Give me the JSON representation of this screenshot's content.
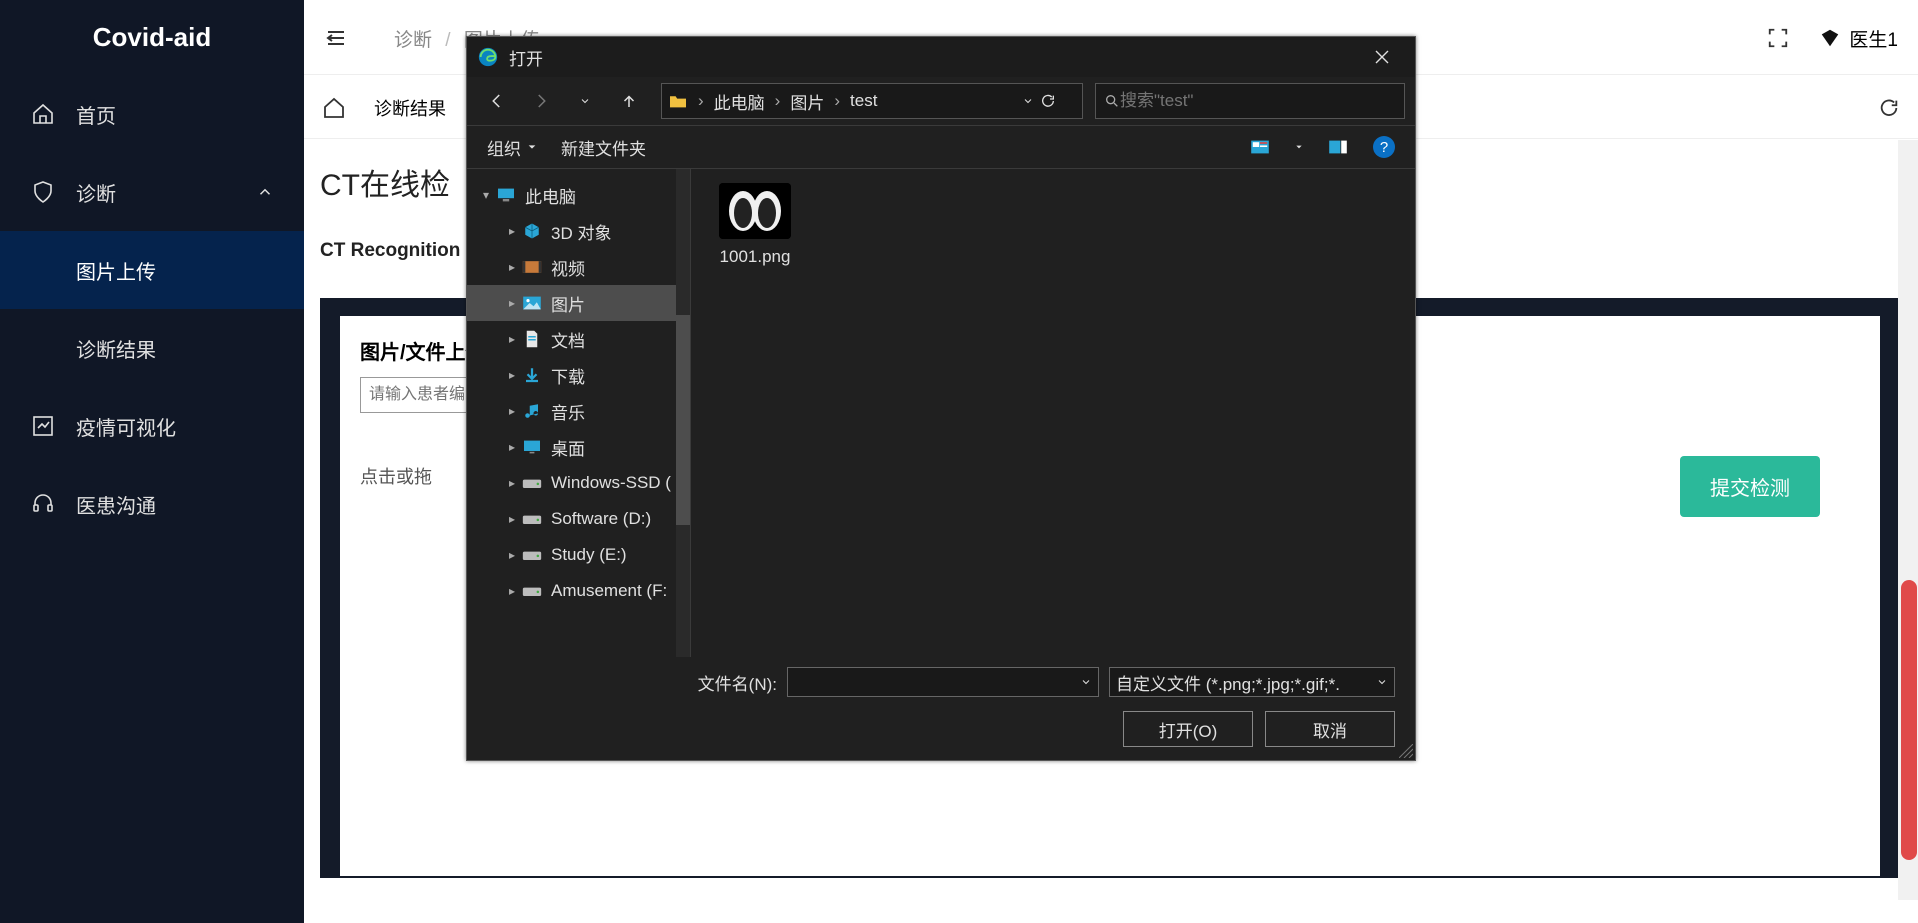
{
  "app": {
    "logo": "Covid-aid"
  },
  "sidebar": {
    "items": [
      {
        "label": "首页",
        "icon": "home-icon"
      },
      {
        "label": "诊断",
        "icon": "shield-icon",
        "expanded": true,
        "children": [
          {
            "label": "图片上传",
            "active": true
          },
          {
            "label": "诊断结果"
          }
        ]
      },
      {
        "label": "疫情可视化",
        "icon": "chart-icon"
      },
      {
        "label": "医患沟通",
        "icon": "headset-icon"
      }
    ]
  },
  "topbar": {
    "breadcrumb": [
      "诊断",
      "图片上传"
    ],
    "user_name": "医生1"
  },
  "breadbar": {
    "tag": "诊断结果"
  },
  "page": {
    "title": "CT在线检",
    "subtitle": "CT Recognition",
    "form_label": "图片/文件上传",
    "patient_placeholder": "请输入患者编",
    "upload_text": "点击或拖",
    "submit_label": "提交检测"
  },
  "dialog": {
    "title": "打开",
    "path_crumbs": [
      "此电脑",
      "图片",
      "test"
    ],
    "search_placeholder": "搜索\"test\"",
    "toolbar": {
      "organize": "组织",
      "new_folder": "新建文件夹"
    },
    "tree": {
      "root": {
        "label": "此电脑"
      },
      "children": [
        {
          "label": "3D 对象",
          "icon": "cube-icon",
          "color": "#2aa6d6"
        },
        {
          "label": "视频",
          "icon": "video-icon",
          "color": "#c77a3a"
        },
        {
          "label": "图片",
          "icon": "pictures-icon",
          "color": "#2aa6d6",
          "selected": true
        },
        {
          "label": "文档",
          "icon": "document-icon",
          "color": "#e8e8e8"
        },
        {
          "label": "下载",
          "icon": "download-icon",
          "color": "#2aa6d6"
        },
        {
          "label": "音乐",
          "icon": "music-icon",
          "color": "#2aa6d6"
        },
        {
          "label": "桌面",
          "icon": "desktop-icon",
          "color": "#2aa6d6"
        },
        {
          "label": "Windows-SSD (",
          "icon": "drive-icon",
          "color": "#bdbdbd"
        },
        {
          "label": "Software (D:)",
          "icon": "drive-icon",
          "color": "#bdbdbd"
        },
        {
          "label": "Study (E:)",
          "icon": "drive-icon",
          "color": "#bdbdbd"
        },
        {
          "label": "Amusement (F:",
          "icon": "drive-icon",
          "color": "#bdbdbd"
        }
      ]
    },
    "files": [
      {
        "name": "1001.png"
      }
    ],
    "filename_label": "文件名(N):",
    "filetype_value": "自定义文件 (*.png;*.jpg;*.gif;*.",
    "open_btn": "打开(O)",
    "cancel_btn": "取消"
  }
}
